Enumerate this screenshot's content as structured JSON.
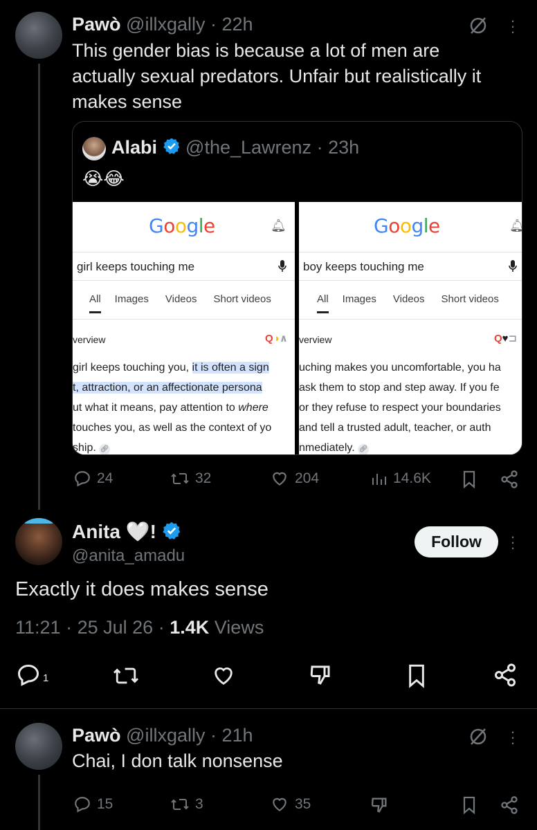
{
  "post1": {
    "author_name": "Pawò",
    "handle": "@illxgally",
    "dot": "·",
    "time": "22h",
    "text_lines": [
      "This gender bias is because a lot of men are",
      "actually sexual predators. Unfair but realistically it",
      "makes sense"
    ],
    "quote": {
      "author_name": "Alabi",
      "handle": "@the_Lawrenz",
      "time": "23h",
      "emoji": "😭😂",
      "left_screen": {
        "logo": "Google",
        "query": "girl keeps touching me",
        "tabs": [
          "All",
          "Images",
          "Videos",
          "Short videos"
        ],
        "overview_label": "verview",
        "lines": [
          "girl keeps touching you, ",
          "it is often a sign",
          "t, attraction, or an affectionate persona",
          "ut what it means, pay attention to ",
          "where",
          " touches you, as well as the context of yo",
          "ship."
        ]
      },
      "right_screen": {
        "logo": "Google",
        "query": "boy keeps touching me",
        "tabs": [
          "All",
          "Images",
          "Videos",
          "Short videos"
        ],
        "overview_label": "verview",
        "lines": [
          "uching makes you uncomfortable, you ha",
          "ask them to stop and step away. If you fe",
          "or they refuse to respect your boundaries",
          " and tell a trusted adult, teacher, or auth",
          "nmediately."
        ]
      }
    },
    "stats": {
      "replies": "24",
      "reposts": "32",
      "likes": "204",
      "views": "14.6K"
    }
  },
  "post2": {
    "author_name": "Anita 🤍!",
    "handle": "@anita_amadu",
    "follow_label": "Follow",
    "text": "Exactly it does makes sense",
    "time": "11:21",
    "date": "25 Jul 26",
    "views_count": "1.4K",
    "views_label": "Views",
    "stats": {
      "replies": "1"
    }
  },
  "post3": {
    "author_name": "Pawò",
    "handle": "@illxgally",
    "time": "21h",
    "text": "Chai, I don talk nonsense",
    "stats": {
      "replies": "15",
      "reposts": "3",
      "likes": "35"
    }
  },
  "colors": {
    "background": "#000000",
    "text": "#e7e9ea",
    "muted": "#71767b",
    "verified": "#1d9bf0",
    "border": "#2f3336"
  }
}
